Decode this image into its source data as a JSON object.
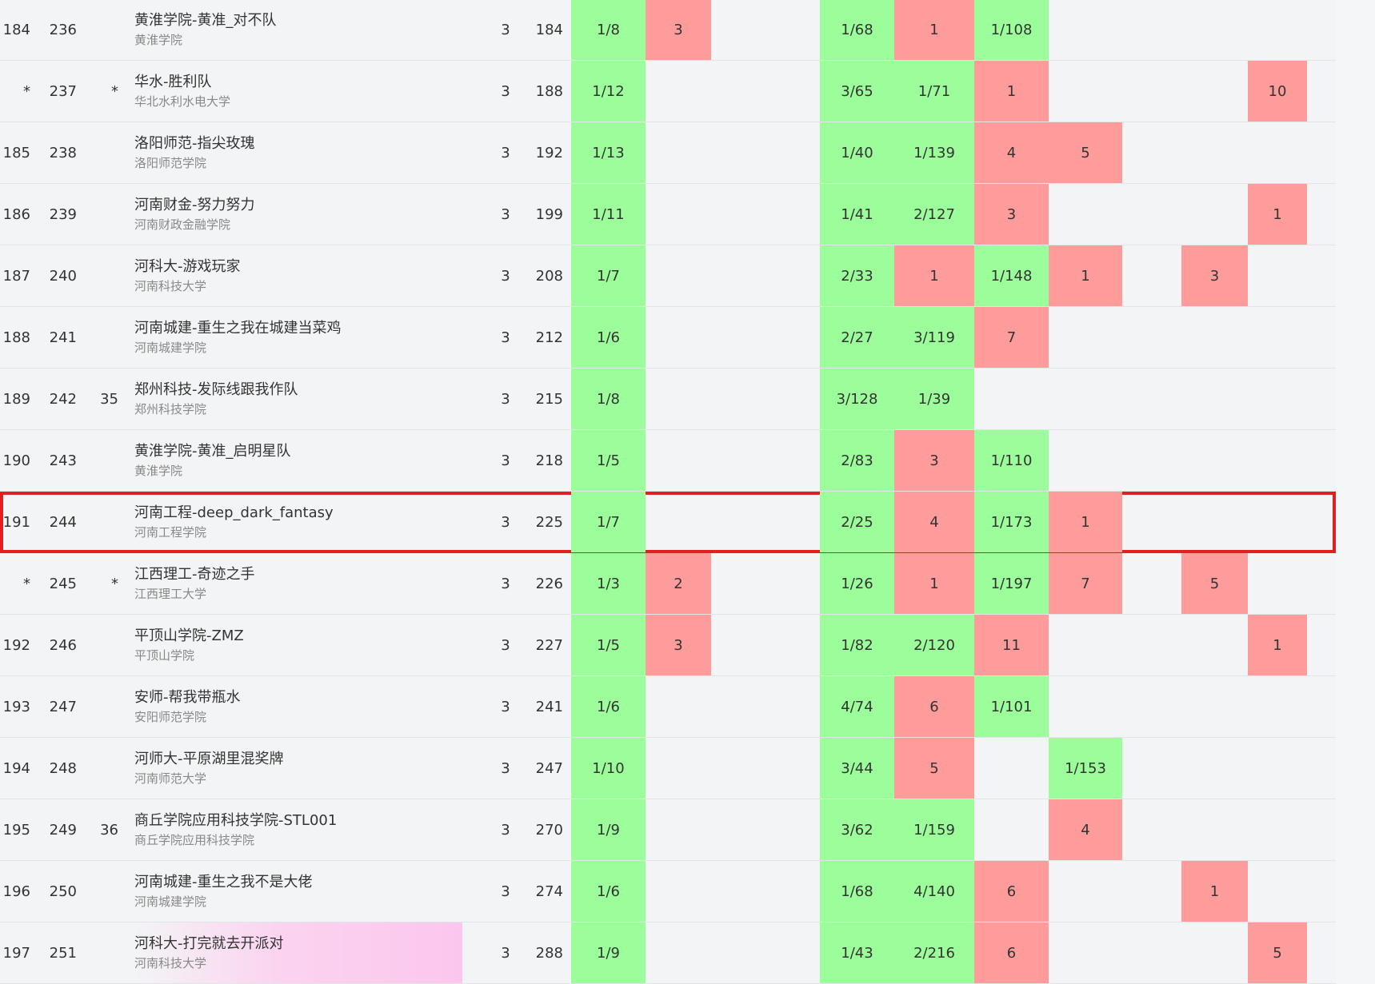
{
  "colors": {
    "accepted": "#9cfe9a",
    "rejected": "#fe9b9b",
    "highlight": "#e02020"
  },
  "rows": [
    {
      "rank": "184",
      "seq": "236",
      "school_rank": "",
      "name": "黄淮学院-黄准_对不队",
      "school": "黄淮学院",
      "solved": "3",
      "penalty": "184",
      "cells": [
        {
          "v": "1/8",
          "s": "ac"
        },
        {
          "v": "3",
          "s": "wa"
        },
        null,
        null,
        {
          "v": "1/68",
          "s": "ac"
        },
        {
          "v": "1",
          "s": "wa"
        },
        {
          "v": "1/108",
          "s": "ac"
        },
        null,
        null,
        null,
        null,
        null
      ]
    },
    {
      "rank": "*",
      "seq": "237",
      "school_rank": "*",
      "name": "华水-胜利队",
      "school": "华北水利水电大学",
      "solved": "3",
      "penalty": "188",
      "cells": [
        {
          "v": "1/12",
          "s": "ac"
        },
        null,
        null,
        null,
        {
          "v": "3/65",
          "s": "ac"
        },
        {
          "v": "1/71",
          "s": "ac"
        },
        {
          "v": "1",
          "s": "wa"
        },
        null,
        null,
        null,
        {
          "v": "10",
          "s": "wa"
        },
        null
      ]
    },
    {
      "rank": "185",
      "seq": "238",
      "school_rank": "",
      "name": "洛阳师范-指尖玫瑰",
      "school": "洛阳师范学院",
      "solved": "3",
      "penalty": "192",
      "cells": [
        {
          "v": "1/13",
          "s": "ac"
        },
        null,
        null,
        null,
        {
          "v": "1/40",
          "s": "ac"
        },
        {
          "v": "1/139",
          "s": "ac"
        },
        {
          "v": "4",
          "s": "wa"
        },
        {
          "v": "5",
          "s": "wa"
        },
        null,
        null,
        null,
        null
      ]
    },
    {
      "rank": "186",
      "seq": "239",
      "school_rank": "",
      "name": "河南财金-努力努力",
      "school": "河南财政金融学院",
      "solved": "3",
      "penalty": "199",
      "cells": [
        {
          "v": "1/11",
          "s": "ac"
        },
        null,
        null,
        null,
        {
          "v": "1/41",
          "s": "ac"
        },
        {
          "v": "2/127",
          "s": "ac"
        },
        {
          "v": "3",
          "s": "wa"
        },
        null,
        null,
        null,
        {
          "v": "1",
          "s": "wa"
        },
        null
      ]
    },
    {
      "rank": "187",
      "seq": "240",
      "school_rank": "",
      "name": "河科大-游戏玩家",
      "school": "河南科技大学",
      "solved": "3",
      "penalty": "208",
      "cells": [
        {
          "v": "1/7",
          "s": "ac"
        },
        null,
        null,
        null,
        {
          "v": "2/33",
          "s": "ac"
        },
        {
          "v": "1",
          "s": "wa"
        },
        {
          "v": "1/148",
          "s": "ac"
        },
        {
          "v": "1",
          "s": "wa"
        },
        null,
        {
          "v": "3",
          "s": "wa"
        },
        null,
        null
      ]
    },
    {
      "rank": "188",
      "seq": "241",
      "school_rank": "",
      "name": "河南城建-重生之我在城建当菜鸡",
      "school": "河南城建学院",
      "solved": "3",
      "penalty": "212",
      "cells": [
        {
          "v": "1/6",
          "s": "ac"
        },
        null,
        null,
        null,
        {
          "v": "2/27",
          "s": "ac"
        },
        {
          "v": "3/119",
          "s": "ac"
        },
        {
          "v": "7",
          "s": "wa"
        },
        null,
        null,
        null,
        null,
        null
      ]
    },
    {
      "rank": "189",
      "seq": "242",
      "school_rank": "35",
      "name": "郑州科技-发际线跟我作队",
      "school": "郑州科技学院",
      "solved": "3",
      "penalty": "215",
      "cells": [
        {
          "v": "1/8",
          "s": "ac"
        },
        null,
        null,
        null,
        {
          "v": "3/128",
          "s": "ac"
        },
        {
          "v": "1/39",
          "s": "ac"
        },
        null,
        null,
        null,
        null,
        null,
        null
      ]
    },
    {
      "rank": "190",
      "seq": "243",
      "school_rank": "",
      "name": "黄淮学院-黄准_启明星队",
      "school": "黄淮学院",
      "solved": "3",
      "penalty": "218",
      "cells": [
        {
          "v": "1/5",
          "s": "ac"
        },
        null,
        null,
        null,
        {
          "v": "2/83",
          "s": "ac"
        },
        {
          "v": "3",
          "s": "wa"
        },
        {
          "v": "1/110",
          "s": "ac"
        },
        null,
        null,
        null,
        null,
        null
      ]
    },
    {
      "rank": "191",
      "seq": "244",
      "school_rank": "",
      "name": "河南工程-deep_dark_fantasy",
      "school": "河南工程学院",
      "solved": "3",
      "penalty": "225",
      "highlight": true,
      "cells": [
        {
          "v": "1/7",
          "s": "ac"
        },
        null,
        null,
        null,
        {
          "v": "2/25",
          "s": "ac"
        },
        {
          "v": "4",
          "s": "wa"
        },
        {
          "v": "1/173",
          "s": "ac"
        },
        {
          "v": "1",
          "s": "wa"
        },
        null,
        null,
        null,
        null
      ]
    },
    {
      "rank": "*",
      "seq": "245",
      "school_rank": "*",
      "name": "江西理工-奇迹之手",
      "school": "江西理工大学",
      "solved": "3",
      "penalty": "226",
      "cells": [
        {
          "v": "1/3",
          "s": "ac"
        },
        {
          "v": "2",
          "s": "wa"
        },
        null,
        null,
        {
          "v": "1/26",
          "s": "ac"
        },
        {
          "v": "1",
          "s": "wa"
        },
        {
          "v": "1/197",
          "s": "ac"
        },
        {
          "v": "7",
          "s": "wa"
        },
        null,
        {
          "v": "5",
          "s": "wa"
        },
        null,
        null
      ]
    },
    {
      "rank": "192",
      "seq": "246",
      "school_rank": "",
      "name": "平顶山学院-ZMZ",
      "school": "平顶山学院",
      "solved": "3",
      "penalty": "227",
      "cells": [
        {
          "v": "1/5",
          "s": "ac"
        },
        {
          "v": "3",
          "s": "wa"
        },
        null,
        null,
        {
          "v": "1/82",
          "s": "ac"
        },
        {
          "v": "2/120",
          "s": "ac"
        },
        {
          "v": "11",
          "s": "wa"
        },
        null,
        null,
        null,
        {
          "v": "1",
          "s": "wa"
        },
        null
      ]
    },
    {
      "rank": "193",
      "seq": "247",
      "school_rank": "",
      "name": "安师-帮我带瓶水",
      "school": "安阳师范学院",
      "solved": "3",
      "penalty": "241",
      "cells": [
        {
          "v": "1/6",
          "s": "ac"
        },
        null,
        null,
        null,
        {
          "v": "4/74",
          "s": "ac"
        },
        {
          "v": "6",
          "s": "wa"
        },
        {
          "v": "1/101",
          "s": "ac"
        },
        null,
        null,
        null,
        null,
        null
      ]
    },
    {
      "rank": "194",
      "seq": "248",
      "school_rank": "",
      "name": "河师大-平原湖里混奖牌",
      "school": "河南师范大学",
      "solved": "3",
      "penalty": "247",
      "cells": [
        {
          "v": "1/10",
          "s": "ac"
        },
        null,
        null,
        null,
        {
          "v": "3/44",
          "s": "ac"
        },
        {
          "v": "5",
          "s": "wa"
        },
        null,
        {
          "v": "1/153",
          "s": "ac"
        },
        null,
        null,
        null,
        null
      ]
    },
    {
      "rank": "195",
      "seq": "249",
      "school_rank": "36",
      "name": "商丘学院应用科技学院-STL001",
      "school": "商丘学院应用科技学院",
      "solved": "3",
      "penalty": "270",
      "cells": [
        {
          "v": "1/9",
          "s": "ac"
        },
        null,
        null,
        null,
        {
          "v": "3/62",
          "s": "ac"
        },
        {
          "v": "1/159",
          "s": "ac"
        },
        null,
        {
          "v": "4",
          "s": "wa"
        },
        null,
        null,
        null,
        null
      ]
    },
    {
      "rank": "196",
      "seq": "250",
      "school_rank": "",
      "name": "河南城建-重生之我不是大佬",
      "school": "河南城建学院",
      "solved": "3",
      "penalty": "274",
      "cells": [
        {
          "v": "1/6",
          "s": "ac"
        },
        null,
        null,
        null,
        {
          "v": "1/68",
          "s": "ac"
        },
        {
          "v": "4/140",
          "s": "ac"
        },
        {
          "v": "6",
          "s": "wa"
        },
        null,
        null,
        {
          "v": "1",
          "s": "wa"
        },
        null,
        null
      ]
    },
    {
      "rank": "197",
      "seq": "251",
      "school_rank": "",
      "name": "河科大-打完就去开派对",
      "school": "河南科技大学",
      "solved": "3",
      "penalty": "288",
      "pink": true,
      "cells": [
        {
          "v": "1/9",
          "s": "ac"
        },
        null,
        null,
        null,
        {
          "v": "1/43",
          "s": "ac"
        },
        {
          "v": "2/216",
          "s": "ac"
        },
        {
          "v": "6",
          "s": "wa"
        },
        null,
        null,
        null,
        {
          "v": "5",
          "s": "wa"
        },
        null
      ]
    }
  ]
}
